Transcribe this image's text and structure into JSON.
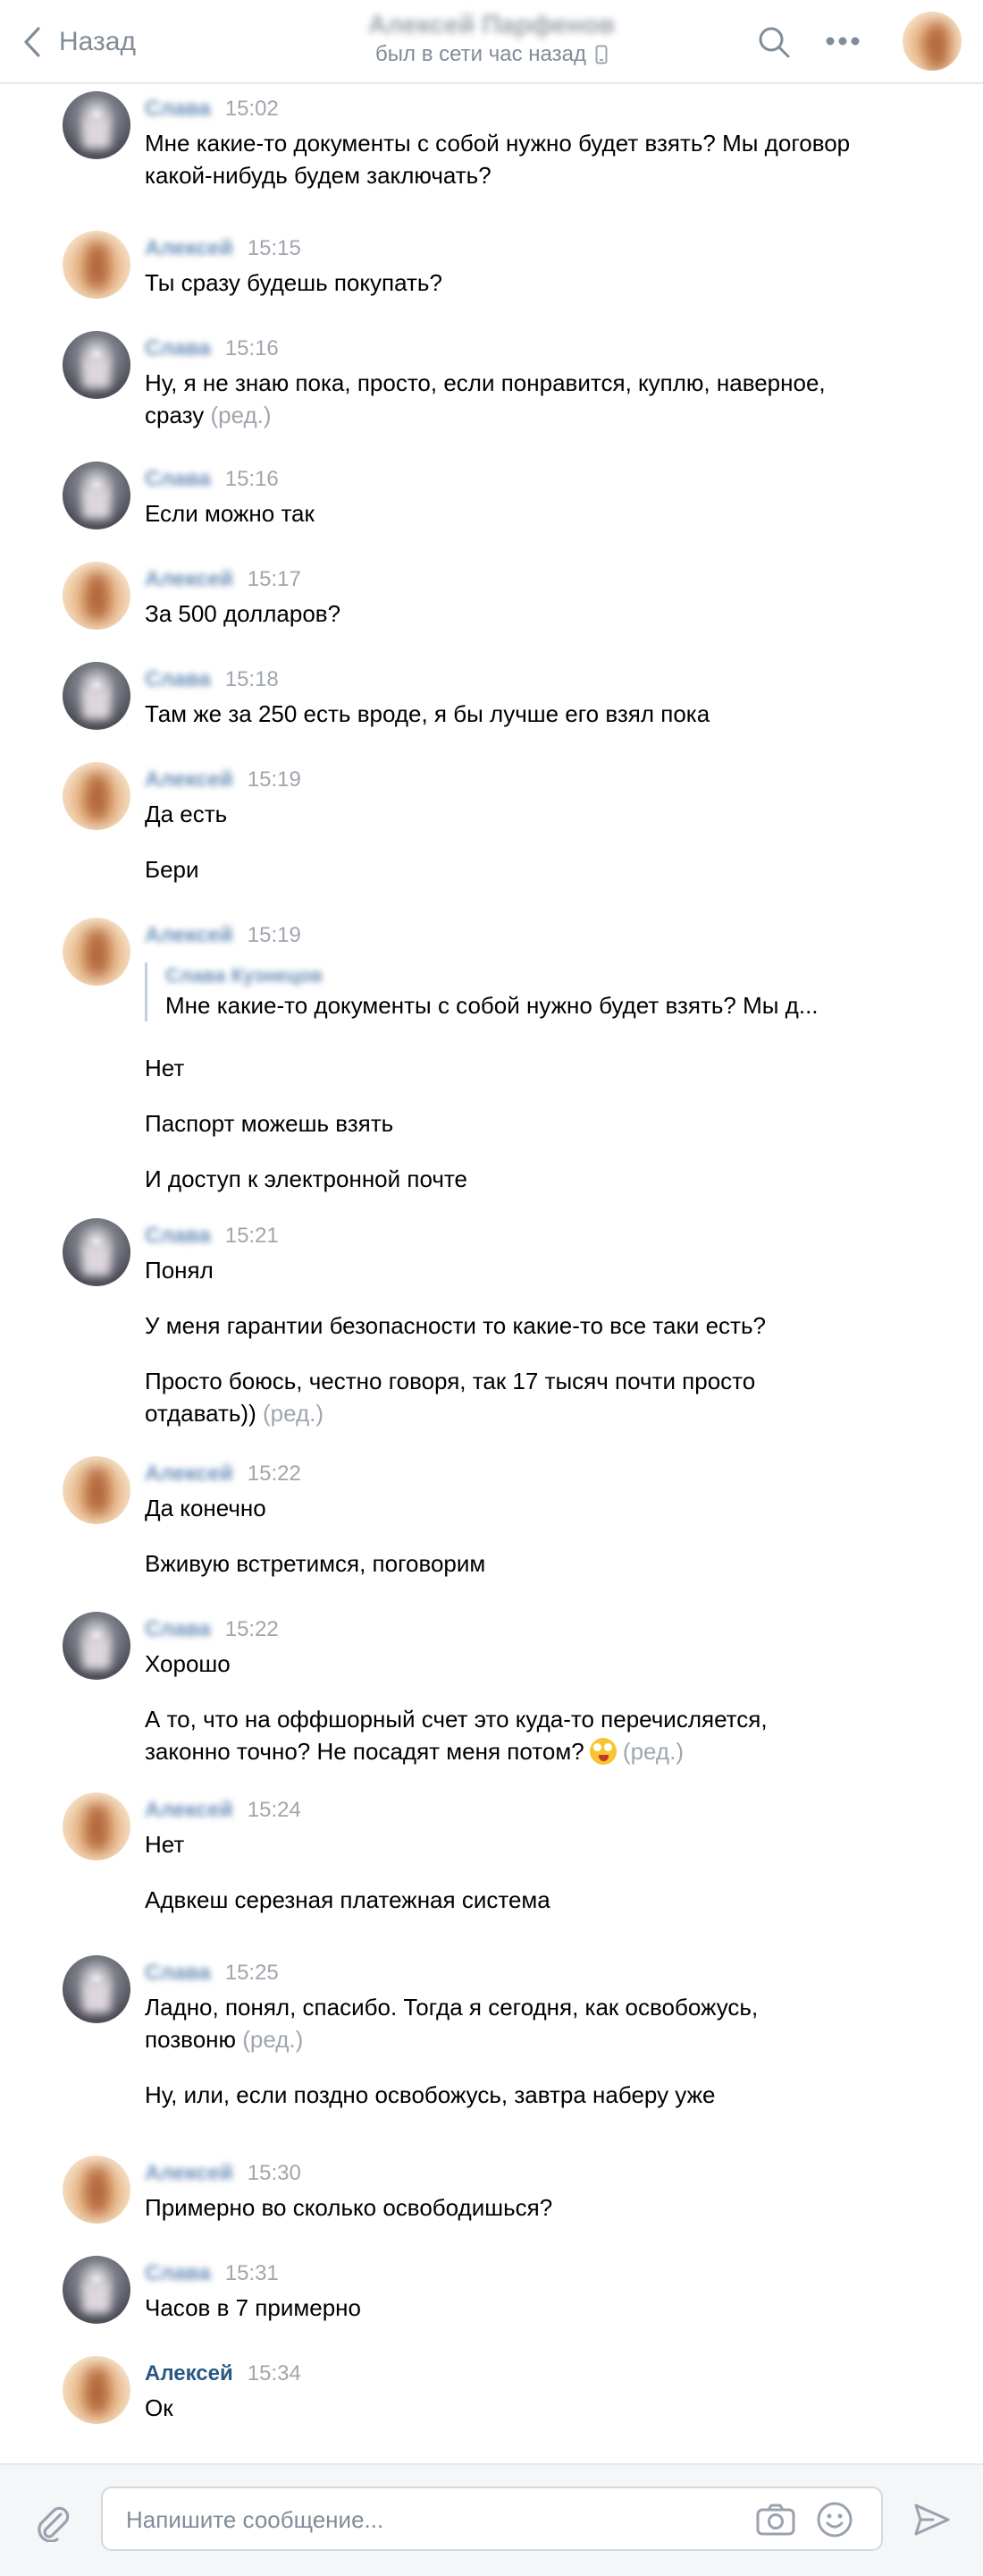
{
  "header": {
    "back_label": "Назад",
    "contact_name": "Алексей Парфенов",
    "status": "был в сети час назад"
  },
  "composer": {
    "placeholder": "Напишите сообщение..."
  },
  "messages": [
    {
      "author": "Слава",
      "time": "15:02",
      "texts": [
        "Мне какие-то документы с собой нужно будет взять? Мы договор какой-нибудь будем заключать?"
      ]
    },
    {
      "author": "Алексей",
      "time": "15:15",
      "texts": [
        "Ты сразу будешь покупать?"
      ]
    },
    {
      "author": "Слава",
      "time": "15:16",
      "texts": [
        "Ну, я не знаю пока, просто, если понравится, куплю, наверное, сразу"
      ],
      "edited": "(ред.)"
    },
    {
      "author": "Слава",
      "time": "15:16",
      "texts": [
        "Если можно так"
      ]
    },
    {
      "author": "Алексей",
      "time": "15:17",
      "texts": [
        "За 500 долларов?"
      ]
    },
    {
      "author": "Слава",
      "time": "15:18",
      "texts": [
        "Там же за 250 есть вроде, я бы лучше его взял пока"
      ]
    },
    {
      "author": "Алексей",
      "time": "15:19",
      "texts": [
        "Да есть",
        "Бери"
      ]
    },
    {
      "author": "Алексей",
      "time": "15:19",
      "quote": {
        "author": "Слава Кузнецов",
        "text": "Мне какие-то документы с собой нужно будет взять? Мы д..."
      },
      "texts": [
        "Нет",
        "Паспорт можешь взять",
        "И доступ к электронной почте"
      ]
    },
    {
      "author": "Слава",
      "time": "15:21",
      "texts": [
        "Понял",
        "У меня гарантии безопасности то какие-то все таки есть?",
        "Просто боюсь, честно говоря, так 17 тысяч почти просто отдавать))"
      ],
      "edited": "(ред.)"
    },
    {
      "author": "Алексей",
      "time": "15:22",
      "texts": [
        "Да конечно",
        "Вживую встретимся, поговорим"
      ]
    },
    {
      "author": "Слава",
      "time": "15:22",
      "texts": [
        "Хорошо",
        "А то, что на оффшорный счет это куда-то перечисляется, законно точно? Не посадят меня потом?"
      ],
      "edited": "(ред.)"
    },
    {
      "author": "Алексей",
      "time": "15:24",
      "texts": [
        "Нет",
        "Адвкеш серезная платежная система"
      ]
    },
    {
      "author": "Слава",
      "time": "15:25",
      "texts": [
        "Ладно, понял, спасибо. Тогда я сегодня, как освобожусь, позвоню",
        "Ну, или, если поздно освобожусь, завтра наберу уже"
      ],
      "edited": "(ред.)"
    },
    {
      "author": "Алексей",
      "time": "15:30",
      "texts": [
        "Примерно во сколько освободишься?"
      ]
    },
    {
      "author": "Слава",
      "time": "15:31",
      "texts": [
        "Часов в 7 примерно"
      ]
    },
    {
      "author": "Алексей",
      "time": "15:34",
      "texts": [
        "Ок"
      ]
    }
  ]
}
